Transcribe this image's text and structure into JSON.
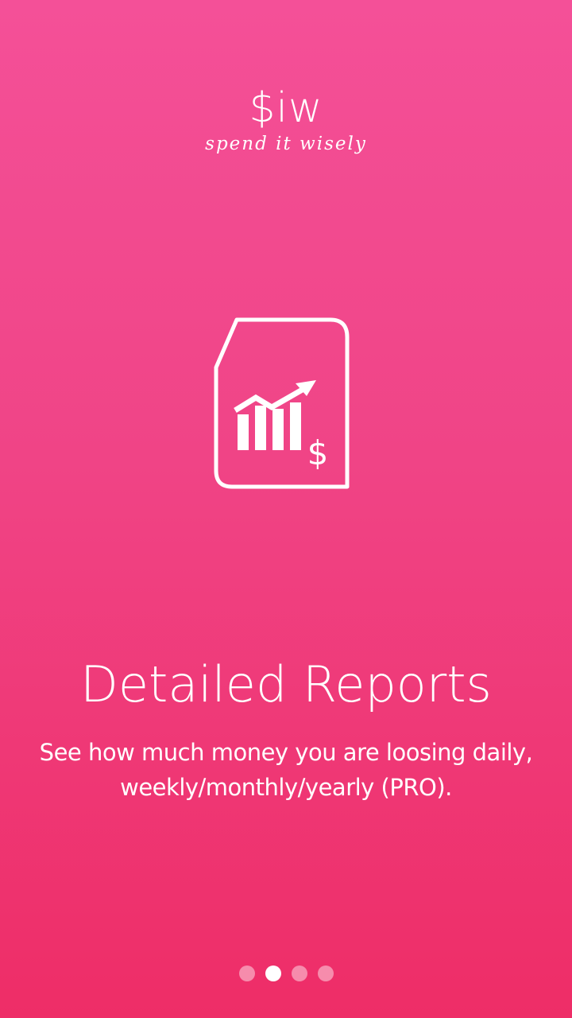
{
  "app": {
    "logo": "$iw",
    "tagline": "spend it wisely"
  },
  "hero": {
    "icon": "report-chart-dollar-icon"
  },
  "slide": {
    "title": "Detailed Reports",
    "description": "See how much money you are loosing daily, weekly/monthly/yearly (PRO)."
  },
  "pager": {
    "total": 4,
    "current": 2
  },
  "colors": {
    "background_top": "#f45098",
    "background_bottom": "#ee2d67",
    "foreground": "#ffffff"
  }
}
